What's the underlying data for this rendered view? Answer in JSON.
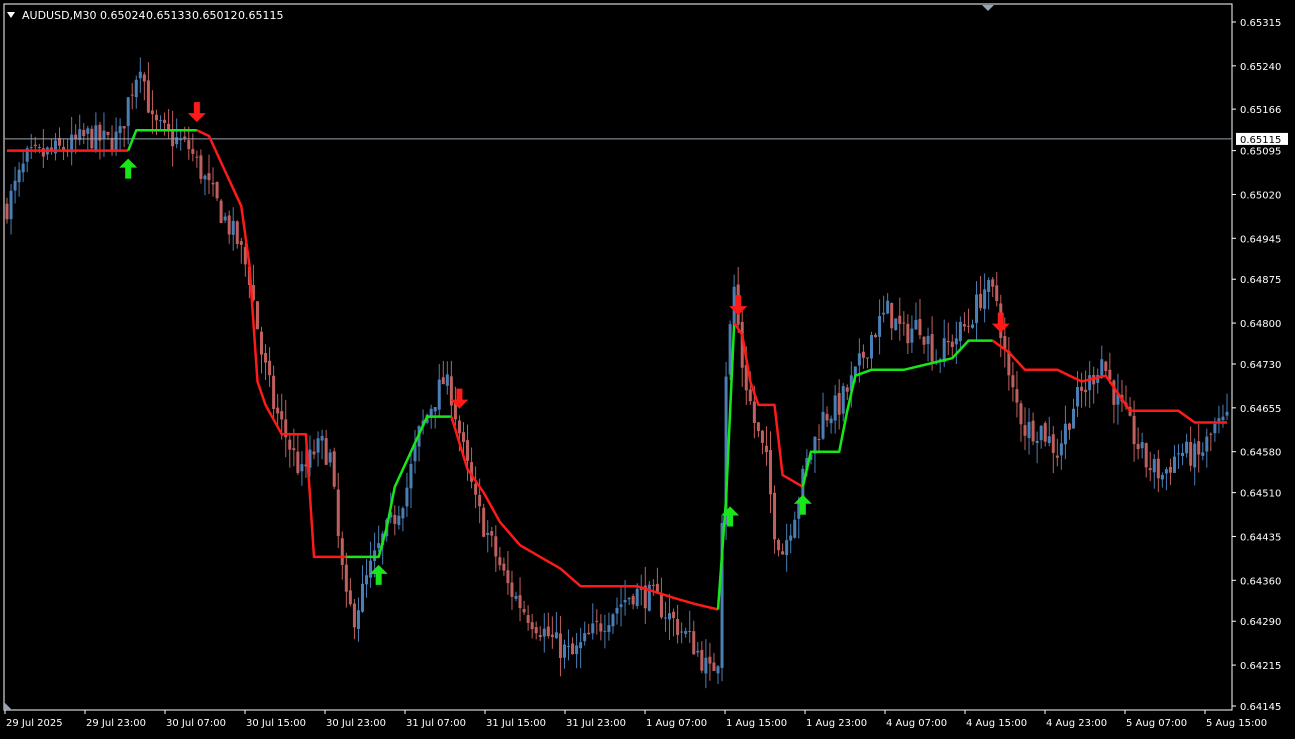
{
  "header": {
    "symbol": "AUDUSD,M30",
    "open": "0.65024",
    "high": "0.65133",
    "low": "0.65012",
    "close": "0.65115",
    "menu_icon": "triangle-down-icon"
  },
  "colors": {
    "background": "#000000",
    "bull_candle": "#4a7fb5",
    "bear_candle": "#c0605e",
    "trail_down": "#ff1a1a",
    "trail_up": "#19e619",
    "bid_line": "#9aa3b0",
    "frame": "#ffffff"
  },
  "chart_data": {
    "type": "candlestick",
    "symbol": "AUDUSD",
    "timeframe": "M30",
    "ylim": [
      0.64145,
      0.65345
    ],
    "y_ticks": [
      "0.65315",
      "0.65240",
      "0.65166",
      "0.65095",
      "0.65020",
      "0.64945",
      "0.64875",
      "0.64800",
      "0.64730",
      "0.64655",
      "0.64580",
      "0.64510",
      "0.64435",
      "0.64360",
      "0.64290",
      "0.64215",
      "0.64145"
    ],
    "y_tick_values": [
      0.65315,
      0.6524,
      0.65166,
      0.65095,
      0.6502,
      0.64945,
      0.64875,
      0.648,
      0.6473,
      0.64655,
      0.6458,
      0.6451,
      0.64435,
      0.6436,
      0.6429,
      0.64215,
      0.64145
    ],
    "current_price": "0.65115",
    "x_ticks": [
      "29 Jul 2025",
      "29 Jul 23:00",
      "30 Jul 07:00",
      "30 Jul 15:00",
      "30 Jul 23:00",
      "31 Jul 07:00",
      "31 Jul 15:00",
      "31 Jul 23:00",
      "1 Aug 07:00",
      "1 Aug 15:00",
      "1 Aug 23:00",
      "4 Aug 07:00",
      "4 Aug 15:00",
      "4 Aug 23:00",
      "5 Aug 07:00",
      "5 Aug 15:00"
    ],
    "close_path": [
      [
        0,
        0.65
      ],
      [
        5,
        0.6508
      ],
      [
        10,
        0.6509
      ],
      [
        15,
        0.651
      ],
      [
        20,
        0.6512
      ],
      [
        25,
        0.6511
      ],
      [
        28,
        0.6512
      ],
      [
        30,
        0.6518
      ],
      [
        33,
        0.6525
      ],
      [
        36,
        0.6514
      ],
      [
        40,
        0.6512
      ],
      [
        45,
        0.651
      ],
      [
        48,
        0.6506
      ],
      [
        50,
        0.6503
      ],
      [
        53,
        0.6499
      ],
      [
        57,
        0.6494
      ],
      [
        60,
        0.6488
      ],
      [
        63,
        0.6475
      ],
      [
        66,
        0.6466
      ],
      [
        70,
        0.6459
      ],
      [
        73,
        0.6454
      ],
      [
        76,
        0.6458
      ],
      [
        78,
        0.6459
      ],
      [
        80,
        0.6457
      ],
      [
        82,
        0.6443
      ],
      [
        84,
        0.6432
      ],
      [
        86,
        0.643
      ],
      [
        88,
        0.6434
      ],
      [
        90,
        0.6438
      ],
      [
        93,
        0.6443
      ],
      [
        96,
        0.6447
      ],
      [
        99,
        0.6452
      ],
      [
        102,
        0.6461
      ],
      [
        105,
        0.6466
      ],
      [
        108,
        0.647
      ],
      [
        110,
        0.6468
      ],
      [
        113,
        0.6458
      ],
      [
        116,
        0.6449
      ],
      [
        120,
        0.6442
      ],
      [
        124,
        0.6435
      ],
      [
        128,
        0.6431
      ],
      [
        132,
        0.6428
      ],
      [
        136,
        0.6425
      ],
      [
        140,
        0.6423
      ],
      [
        145,
        0.6427
      ],
      [
        150,
        0.6431
      ],
      [
        155,
        0.6434
      ],
      [
        160,
        0.6433
      ],
      [
        165,
        0.6429
      ],
      [
        170,
        0.6425
      ],
      [
        174,
        0.642
      ],
      [
        176,
        0.6423
      ],
      [
        178,
        0.6472
      ],
      [
        180,
        0.6486
      ],
      [
        182,
        0.6473
      ],
      [
        185,
        0.6463
      ],
      [
        188,
        0.6456
      ],
      [
        190,
        0.6445
      ],
      [
        192,
        0.6441
      ],
      [
        195,
        0.6448
      ],
      [
        198,
        0.6456
      ],
      [
        202,
        0.6464
      ],
      [
        206,
        0.6466
      ],
      [
        210,
        0.6471
      ],
      [
        214,
        0.6478
      ],
      [
        218,
        0.6482
      ],
      [
        222,
        0.6478
      ],
      [
        226,
        0.648
      ],
      [
        230,
        0.6474
      ],
      [
        234,
        0.6477
      ],
      [
        238,
        0.648
      ],
      [
        242,
        0.6486
      ],
      [
        245,
        0.6484
      ],
      [
        248,
        0.647
      ],
      [
        252,
        0.6462
      ],
      [
        256,
        0.6462
      ],
      [
        260,
        0.6458
      ],
      [
        264,
        0.6466
      ],
      [
        268,
        0.647
      ],
      [
        271,
        0.6474
      ],
      [
        274,
        0.6468
      ],
      [
        278,
        0.6462
      ],
      [
        282,
        0.6456
      ],
      [
        286,
        0.6454
      ],
      [
        290,
        0.6458
      ],
      [
        295,
        0.6457
      ],
      [
        299,
        0.6462
      ],
      [
        302,
        0.6463
      ]
    ],
    "trailing_stop": [
      {
        "color": "red",
        "points": [
          [
            0,
            0.65095
          ],
          [
            30,
            0.65095
          ]
        ]
      },
      {
        "color": "green",
        "points": [
          [
            30,
            0.65095
          ],
          [
            32,
            0.6513
          ],
          [
            47,
            0.6513
          ]
        ]
      },
      {
        "color": "red",
        "points": [
          [
            47,
            0.6513
          ],
          [
            50,
            0.6512
          ],
          [
            54,
            0.6506
          ],
          [
            58,
            0.65
          ],
          [
            60,
            0.649
          ],
          [
            62,
            0.647
          ],
          [
            64,
            0.6466
          ],
          [
            68,
            0.6461
          ],
          [
            74,
            0.6461
          ],
          [
            76,
            0.644
          ],
          [
            84,
            0.644
          ]
        ]
      },
      {
        "color": "green",
        "points": [
          [
            84,
            0.644
          ],
          [
            92,
            0.644
          ],
          [
            94,
            0.6445
          ],
          [
            96,
            0.6452
          ],
          [
            100,
            0.6458
          ],
          [
            104,
            0.6464
          ],
          [
            110,
            0.6464
          ]
        ]
      },
      {
        "color": "red",
        "points": [
          [
            110,
            0.6464
          ],
          [
            114,
            0.6455
          ],
          [
            118,
            0.6451
          ],
          [
            122,
            0.6446
          ],
          [
            127,
            0.6442
          ],
          [
            132,
            0.644
          ],
          [
            137,
            0.6438
          ],
          [
            142,
            0.6435
          ],
          [
            156,
            0.6435
          ],
          [
            165,
            0.6433
          ],
          [
            170,
            0.6432
          ],
          [
            176,
            0.6431
          ]
        ]
      },
      {
        "color": "green",
        "points": [
          [
            176,
            0.6431
          ],
          [
            178,
            0.645
          ],
          [
            180,
            0.648
          ]
        ]
      },
      {
        "color": "red",
        "points": [
          [
            180,
            0.648
          ],
          [
            182,
            0.6478
          ],
          [
            184,
            0.647
          ],
          [
            186,
            0.6466
          ],
          [
            190,
            0.6466
          ],
          [
            192,
            0.6454
          ],
          [
            197,
            0.6452
          ]
        ]
      },
      {
        "color": "green",
        "points": [
          [
            197,
            0.6452
          ],
          [
            199,
            0.6458
          ],
          [
            206,
            0.6458
          ],
          [
            208,
            0.6465
          ],
          [
            210,
            0.6471
          ],
          [
            214,
            0.6472
          ],
          [
            222,
            0.6472
          ],
          [
            228,
            0.6473
          ],
          [
            234,
            0.6474
          ],
          [
            238,
            0.6477
          ],
          [
            244,
            0.6477
          ]
        ]
      },
      {
        "color": "red",
        "points": [
          [
            244,
            0.6477
          ],
          [
            248,
            0.6475
          ],
          [
            252,
            0.6472
          ],
          [
            260,
            0.6472
          ],
          [
            266,
            0.647
          ],
          [
            272,
            0.6471
          ],
          [
            278,
            0.6465
          ],
          [
            290,
            0.6465
          ],
          [
            294,
            0.6463
          ],
          [
            302,
            0.6463
          ]
        ]
      }
    ],
    "signals": [
      {
        "type": "buy",
        "bar": 30
      },
      {
        "type": "sell",
        "bar": 47
      },
      {
        "type": "buy",
        "bar": 92
      },
      {
        "type": "sell",
        "bar": 112
      },
      {
        "type": "buy",
        "bar": 179
      },
      {
        "type": "sell",
        "bar": 181
      },
      {
        "type": "buy",
        "bar": 197
      },
      {
        "type": "sell",
        "bar": 246
      }
    ]
  }
}
